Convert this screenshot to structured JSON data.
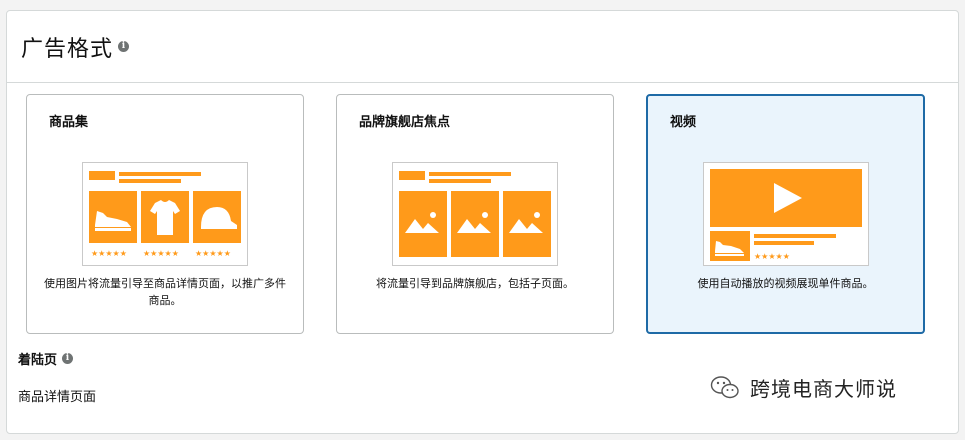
{
  "section": {
    "title": "广告格式"
  },
  "formats": [
    {
      "title": "商品集",
      "description": "使用图片将流量引导至商品详情页面，以推广多件商品。",
      "selected": false
    },
    {
      "title": "品牌旗舰店焦点",
      "description": "将流量引导到品牌旗舰店，包括子页面。",
      "selected": false
    },
    {
      "title": "视频",
      "description": "使用自动播放的视频展现单件商品。",
      "selected": true
    }
  ],
  "landing_page": {
    "label": "着陆页",
    "value": "商品详情页面"
  },
  "watermark": {
    "text": "跨境电商大师说"
  },
  "colors": {
    "accent_orange": "#ff9a1a",
    "selected_border": "#1e6aa6",
    "selected_bg": "#eaf4fc"
  }
}
